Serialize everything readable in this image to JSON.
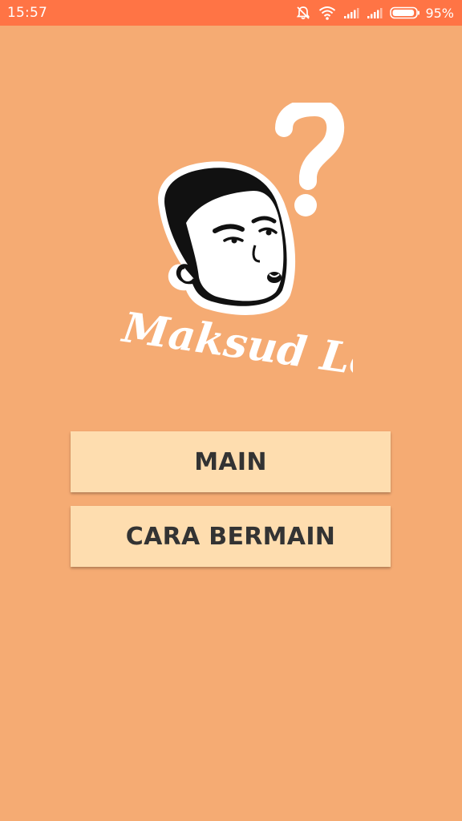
{
  "status_bar": {
    "time": "15:57",
    "battery_percent": "95%",
    "battery_level": 0.95,
    "icons": [
      "alarm-off-icon",
      "wifi-icon",
      "signal-icon",
      "signal-icon",
      "battery-icon"
    ]
  },
  "logo": {
    "text": "Maksud Lo?",
    "icon": "confused-face-logo"
  },
  "menu": {
    "main_label": "MAIN",
    "howto_label": "CARA BERMAIN"
  },
  "colors": {
    "background": "#F5AB73",
    "status_bar": "#FF7445",
    "button": "#FEDDAF",
    "button_text": "#333333"
  }
}
